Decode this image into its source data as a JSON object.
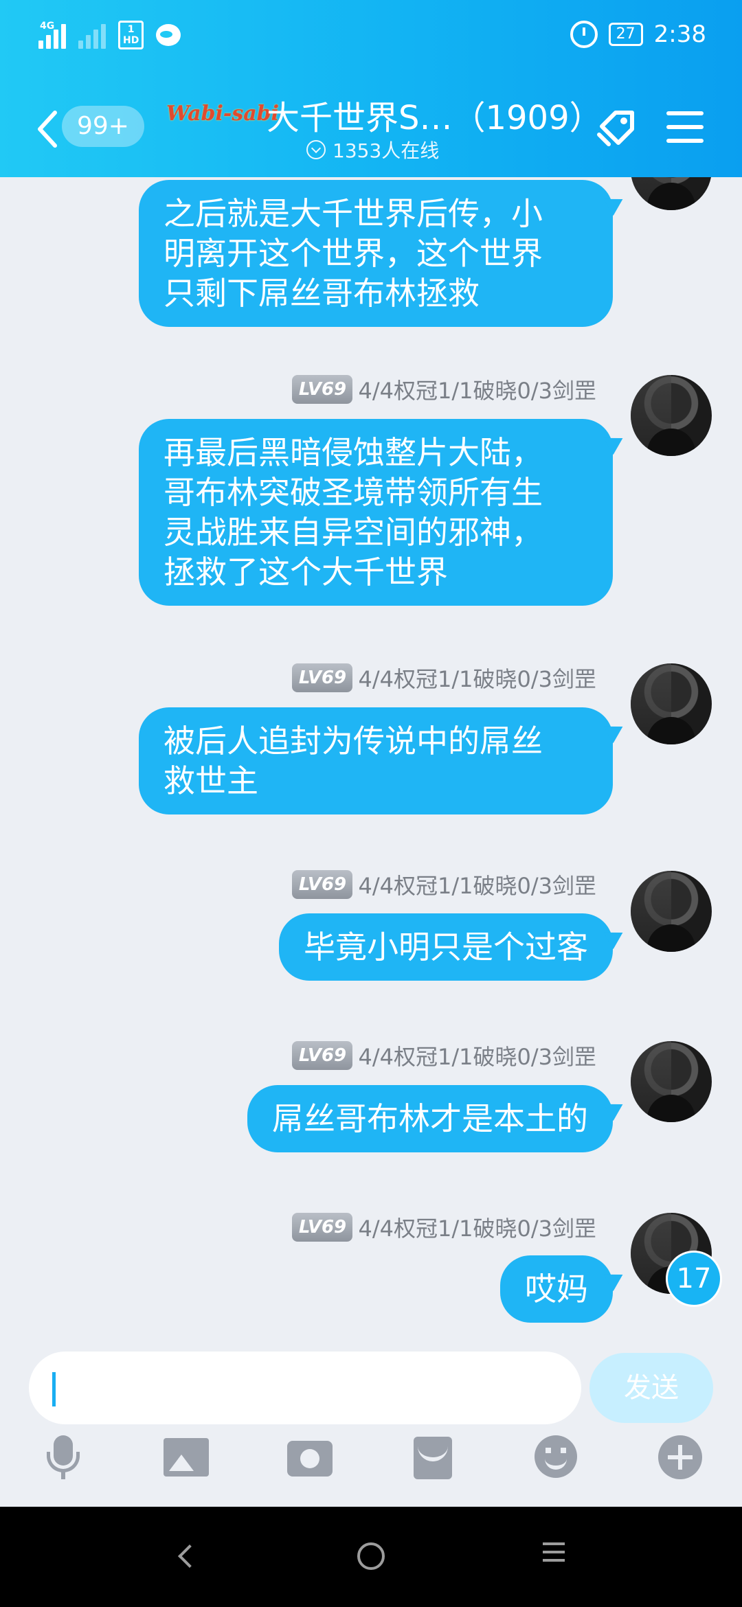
{
  "status_bar": {
    "network": "4G",
    "hd_slot": "1",
    "hd_label": "HD",
    "battery": "27",
    "time": "2:38"
  },
  "header": {
    "back_badge": "99+",
    "logo_text": "Wabi-sabi",
    "title": "大千世界S…（1909）",
    "online": "1353人在线"
  },
  "messages": [
    {
      "meta": "",
      "text_lines": [
        "之后就是大千世界后传，小",
        "明离开这个世界，这个世界",
        "只剩下屌丝哥布林拯救"
      ]
    },
    {
      "meta": "4/4权冠1/1破晓0/3剑罡",
      "level": "LV69",
      "text_lines": [
        "再最后黑暗侵蚀整片大陆，",
        "哥布林突破圣境带领所有生",
        "灵战胜来自异空间的邪神，",
        "拯救了这个大千世界"
      ]
    },
    {
      "meta": "4/4权冠1/1破晓0/3剑罡",
      "level": "LV69",
      "text_lines": [
        "被后人追封为传说中的屌丝",
        "救世主"
      ]
    },
    {
      "meta": "4/4权冠1/1破晓0/3剑罡",
      "level": "LV69",
      "text_lines": [
        "毕竟小明只是个过客"
      ]
    },
    {
      "meta": "4/4权冠1/1破晓0/3剑罡",
      "level": "LV69",
      "text_lines": [
        "屌丝哥布林才是本土的"
      ]
    },
    {
      "meta": "4/4权冠1/1破晓0/3剑罡",
      "level": "LV69",
      "text_lines": [
        "哎妈"
      ]
    }
  ],
  "unread_count": "17",
  "input": {
    "value": "",
    "send_label": "发送"
  },
  "toolbar": [
    "mic-icon",
    "image-icon",
    "camera-icon",
    "red-packet-icon",
    "emoji-icon",
    "plus-icon"
  ],
  "colors": {
    "accent": "#1fb5f5",
    "header_start": "#21c9f5",
    "header_end": "#0a9ff0",
    "background": "#eceff4"
  }
}
